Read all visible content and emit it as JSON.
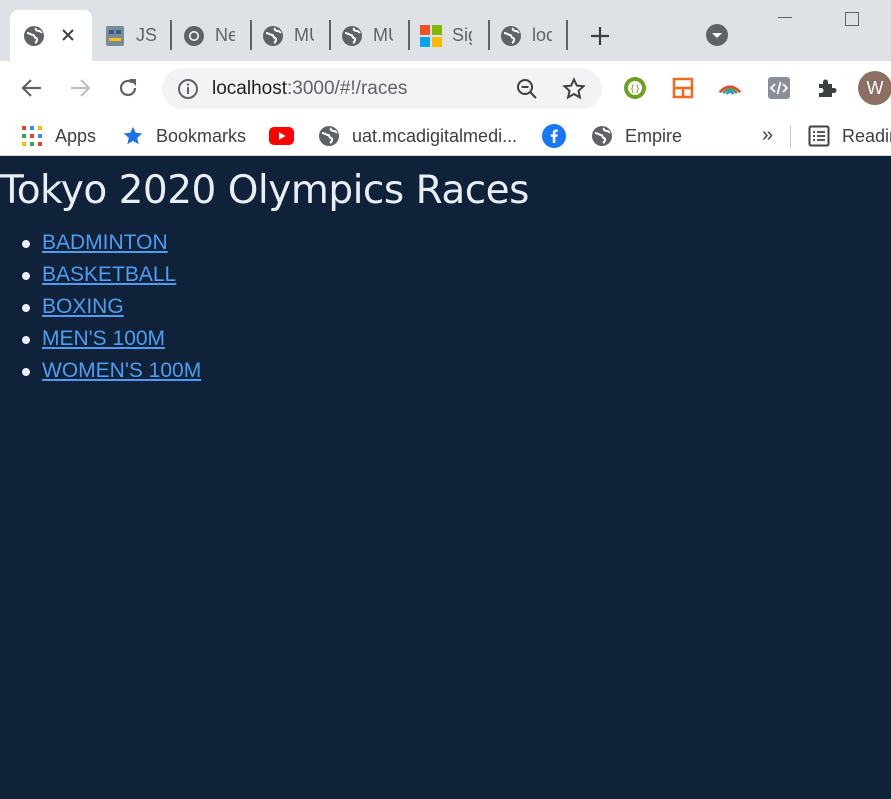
{
  "browser": {
    "tabs": [
      {
        "title": "",
        "active": true
      },
      {
        "title": "JS"
      },
      {
        "title": "Ne"
      },
      {
        "title": "MU"
      },
      {
        "title": "MU"
      },
      {
        "title": "Sig"
      },
      {
        "title": "loc"
      }
    ],
    "url_host": "localhost",
    "url_path": ":3000/#!/races",
    "avatar_letter": "W"
  },
  "bookmarks": [
    {
      "label": "Apps",
      "icon": "apps-grid-icon"
    },
    {
      "label": "Bookmarks",
      "icon": "star-icon"
    },
    {
      "label": "",
      "icon": "youtube-icon"
    },
    {
      "label": "uat.mcadigitalmedi...",
      "icon": "globe-icon"
    },
    {
      "label": "",
      "icon": "facebook-icon"
    },
    {
      "label": "Empire",
      "icon": "globe-icon"
    },
    {
      "label": "Readin",
      "icon": "reading-list-icon"
    }
  ],
  "bookmarks_overflow": "»",
  "page": {
    "title": "Tokyo 2020 Olympics Races",
    "races": [
      "BADMINTON",
      "BASKETBALL",
      "BOXING",
      "MEN'S 100M",
      "WOMEN'S 100M"
    ]
  },
  "colors": {
    "page_background": "#10223a",
    "link": "#4f9cf0",
    "heading": "#e9eef4"
  }
}
